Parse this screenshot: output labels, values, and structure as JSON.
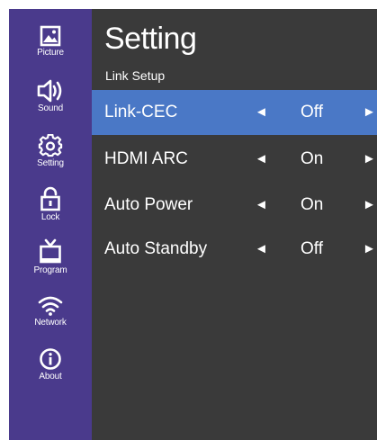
{
  "sidebar": {
    "items": [
      {
        "label": "Picture",
        "icon": "picture-icon"
      },
      {
        "label": "Sound",
        "icon": "speaker-icon"
      },
      {
        "label": "Setting",
        "icon": "gear-icon"
      },
      {
        "label": "Lock",
        "icon": "lock-icon"
      },
      {
        "label": "Program",
        "icon": "tv-icon"
      },
      {
        "label": "Network",
        "icon": "wifi-icon"
      },
      {
        "label": "About",
        "icon": "info-icon"
      }
    ]
  },
  "header": {
    "title": "Setting",
    "subtitle": "Link Setup"
  },
  "settings": [
    {
      "label": "Link-CEC",
      "value": "Off",
      "selected": true
    },
    {
      "label": "HDMI ARC",
      "value": "On",
      "selected": false
    },
    {
      "label": "Auto Power",
      "value": "On",
      "selected": false
    },
    {
      "label": "Auto Standby",
      "value": "Off",
      "selected": false
    }
  ],
  "glyphs": {
    "left_arrow": "◄",
    "right_arrow": "►"
  },
  "colors": {
    "sidebar_bg": "#4a3a8c",
    "panel_bg": "#3a3a3a",
    "selected_row": "#4a78c6",
    "text": "#ffffff"
  }
}
